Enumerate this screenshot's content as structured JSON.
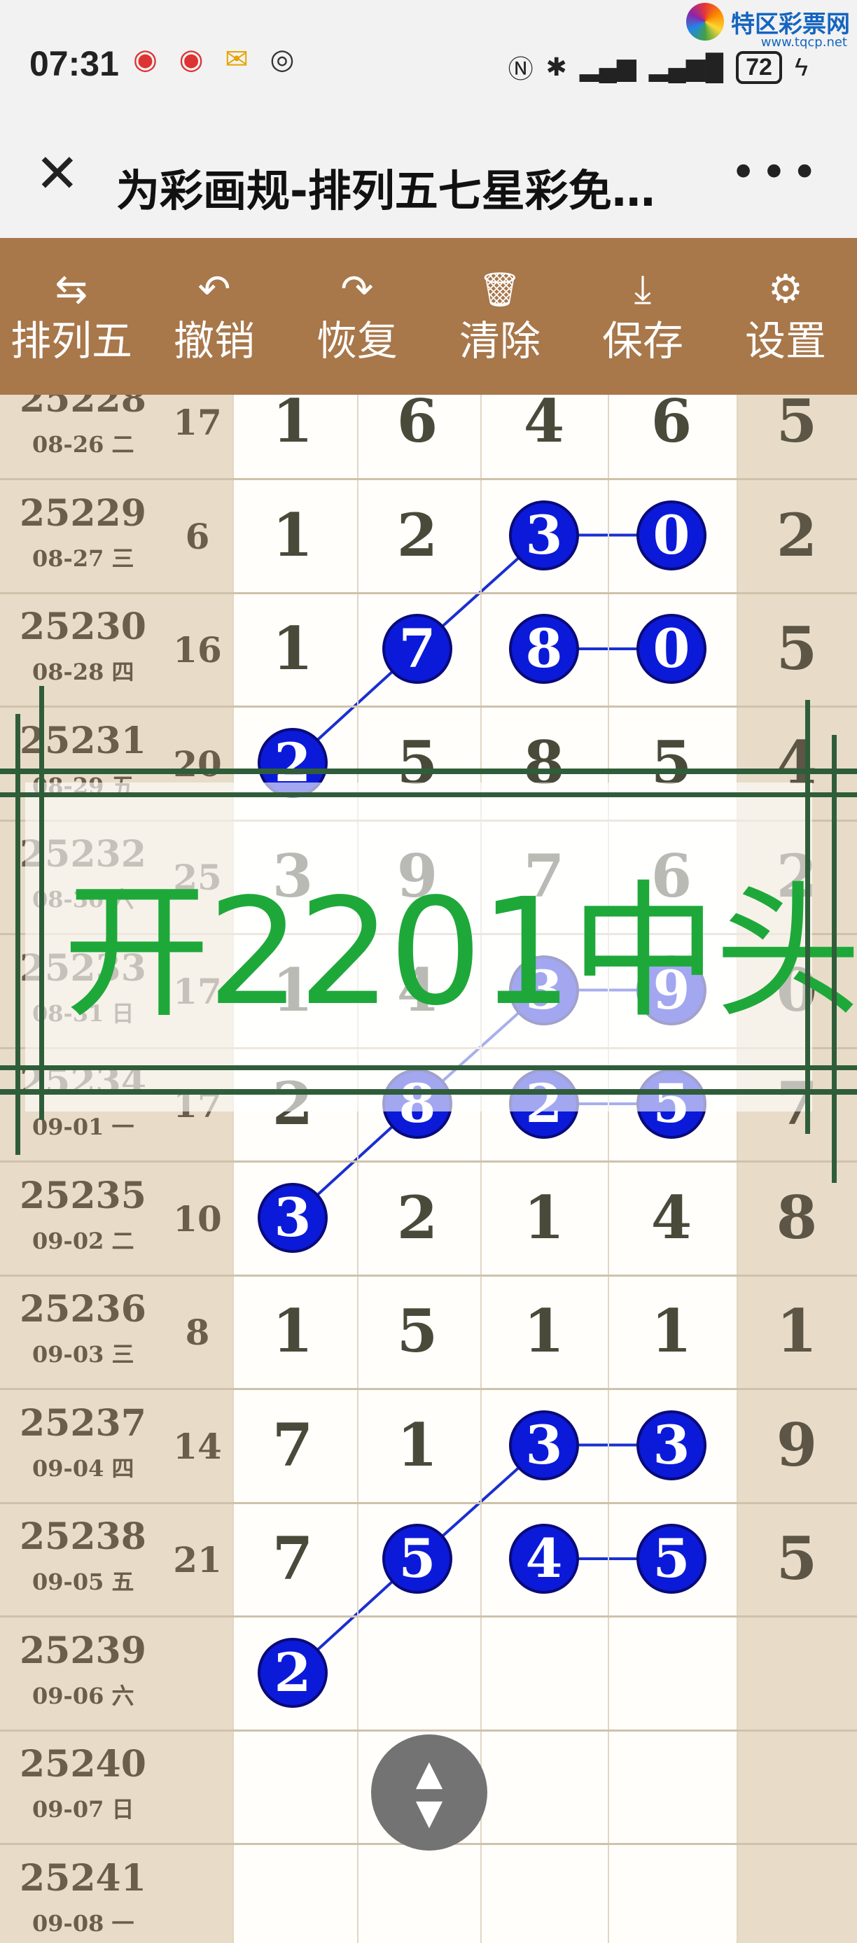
{
  "status_bar": {
    "time": "07:31",
    "battery": "72",
    "icons_left": [
      "weibo-icon",
      "weibo-icon",
      "mail-icon",
      "eye-icon"
    ],
    "icons_right": [
      "nfc-icon",
      "bluetooth-icon",
      "signal-icon",
      "4g-signal-icon",
      "charging-icon"
    ]
  },
  "watermark": {
    "site_name": "特区彩票网",
    "site_url": "www.tqcp.net"
  },
  "titlebar": {
    "title": "为彩画规-排列五七星彩免…",
    "close": "✕",
    "more": "•••"
  },
  "toolbar": {
    "items": [
      {
        "label": "排列五",
        "icon": "swap-icon",
        "glyph": "⇆"
      },
      {
        "label": "撤销",
        "icon": "undo-icon",
        "glyph": "↶"
      },
      {
        "label": "恢复",
        "icon": "redo-icon",
        "glyph": "↷"
      },
      {
        "label": "清除",
        "icon": "trash-icon",
        "glyph": "🗑"
      },
      {
        "label": "保存",
        "icon": "download-icon",
        "glyph": "⤓"
      },
      {
        "label": "设置",
        "icon": "gear-icon",
        "glyph": "⚙"
      }
    ],
    "background": "#a8774a"
  },
  "rows": [
    {
      "issue": "25228",
      "date": "08-26 二",
      "sum": "17",
      "digits": [
        "1",
        "6",
        "4",
        "6"
      ],
      "last": "5",
      "balls": []
    },
    {
      "issue": "25229",
      "date": "08-27 三",
      "sum": "6",
      "digits": [
        "1",
        "2",
        "3",
        "0"
      ],
      "last": "2",
      "balls": [
        2,
        3
      ]
    },
    {
      "issue": "25230",
      "date": "08-28 四",
      "sum": "16",
      "digits": [
        "1",
        "7",
        "8",
        "0"
      ],
      "last": "5",
      "balls": [
        1,
        2,
        3
      ]
    },
    {
      "issue": "25231",
      "date": "08-29 五",
      "sum": "20",
      "digits": [
        "2",
        "5",
        "8",
        "5"
      ],
      "last": "4",
      "balls": [
        0
      ]
    },
    {
      "issue": "25232",
      "date": "08-30 六",
      "sum": "25",
      "digits": [
        "3",
        "9",
        "7",
        "6"
      ],
      "last": "2",
      "balls": []
    },
    {
      "issue": "25233",
      "date": "08-31 日",
      "sum": "17",
      "digits": [
        "1",
        "4",
        "3",
        "9"
      ],
      "last": "0",
      "balls": [
        2,
        3
      ]
    },
    {
      "issue": "25234",
      "date": "09-01 一",
      "sum": "17",
      "digits": [
        "2",
        "8",
        "2",
        "5"
      ],
      "last": "7",
      "balls": [
        1,
        2,
        3
      ]
    },
    {
      "issue": "25235",
      "date": "09-02 二",
      "sum": "10",
      "digits": [
        "3",
        "2",
        "1",
        "4"
      ],
      "last": "8",
      "balls": [
        0
      ]
    },
    {
      "issue": "25236",
      "date": "09-03 三",
      "sum": "8",
      "digits": [
        "1",
        "5",
        "1",
        "1"
      ],
      "last": "1",
      "balls": []
    },
    {
      "issue": "25237",
      "date": "09-04 四",
      "sum": "14",
      "digits": [
        "7",
        "1",
        "3",
        "3"
      ],
      "last": "9",
      "balls": [
        2,
        3
      ]
    },
    {
      "issue": "25238",
      "date": "09-05 五",
      "sum": "21",
      "digits": [
        "7",
        "5",
        "4",
        "5"
      ],
      "last": "5",
      "balls": [
        1,
        2,
        3
      ]
    },
    {
      "issue": "25239",
      "date": "09-06 六",
      "sum": "",
      "digits": [
        "2",
        "",
        "",
        ""
      ],
      "last": "",
      "balls": [
        0
      ]
    },
    {
      "issue": "25240",
      "date": "09-07 日",
      "sum": "",
      "digits": [
        "",
        "",
        "",
        ""
      ],
      "last": "",
      "balls": []
    },
    {
      "issue": "25241",
      "date": "09-08 一",
      "sum": "",
      "digits": [
        "",
        "",
        "",
        ""
      ],
      "last": "",
      "balls": []
    }
  ],
  "overlay": {
    "text": "开2201中头",
    "color": "#1fa83a"
  },
  "scroll_button": {
    "up": "▲",
    "down": "▼"
  },
  "colors": {
    "ball": "#0b1ad8",
    "grid_bg": "#e8dcc8",
    "main_bg": "#fffefb"
  }
}
